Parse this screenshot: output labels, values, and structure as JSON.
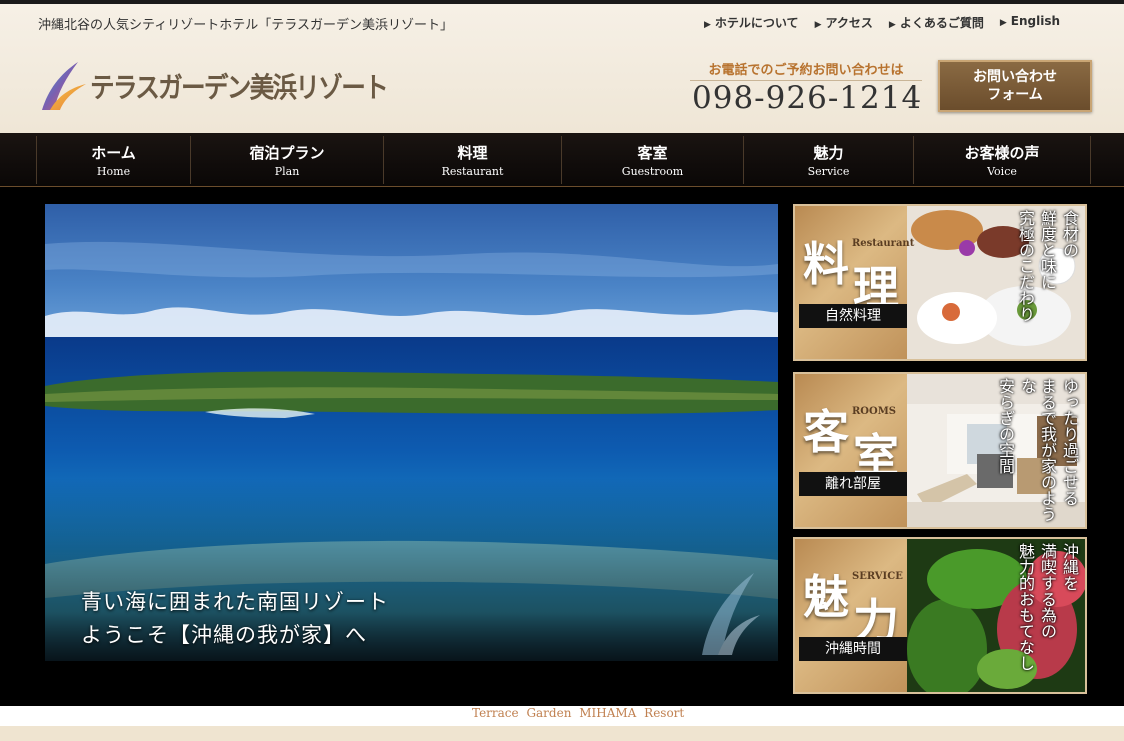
{
  "header": {
    "tagline": "沖縄北谷の人気シティリゾートホテル「テラスガーデン美浜リゾート」",
    "utility_links": [
      "ホテルについて",
      "アクセス",
      "よくあるご質問",
      "English"
    ],
    "logo_text": "テラスガーデン美浜リゾート",
    "contact_label": "お電話でのご予約お問い合わせは",
    "phone": "098-926-1214",
    "contact_button": [
      "お問い合わせ",
      "フォーム"
    ]
  },
  "nav": [
    {
      "jp": "ホーム",
      "en": "Home"
    },
    {
      "jp": "宿泊プラン",
      "en": "Plan"
    },
    {
      "jp": "料理",
      "en": "Restaurant"
    },
    {
      "jp": "客室",
      "en": "Guestroom"
    },
    {
      "jp": "魅力",
      "en": "Service"
    },
    {
      "jp": "お客様の声",
      "en": "Voice"
    }
  ],
  "hero": {
    "caption_line1": "青い海に囲まれた南国リゾート",
    "caption_line2": "ようこそ【沖縄の我が家】へ"
  },
  "cards": [
    {
      "k1": "料",
      "k2": "理",
      "en": "Restaurant",
      "sub": "自然料理",
      "vtext": [
        "食材の",
        "鮮度と味に",
        "究極のこだわり"
      ]
    },
    {
      "k1": "客",
      "k2": "室",
      "en": "ROOMS",
      "sub": "離れ部屋",
      "vtext": [
        "ゆったり過ごせる",
        "まるで我が家のような",
        "安らぎの空間"
      ]
    },
    {
      "k1": "魅",
      "k2": "力",
      "en": "SERVICE",
      "sub": "沖縄時間",
      "vtext": [
        "沖縄を",
        "満喫する為の",
        "魅力的おもてなし"
      ]
    }
  ],
  "footer": {
    "text": "Terrace Garden MIHAMA Resort"
  },
  "colors": {
    "accent_gold": "#c9a574",
    "brown": "#6b4d2c",
    "orange_label": "#b8732f"
  }
}
